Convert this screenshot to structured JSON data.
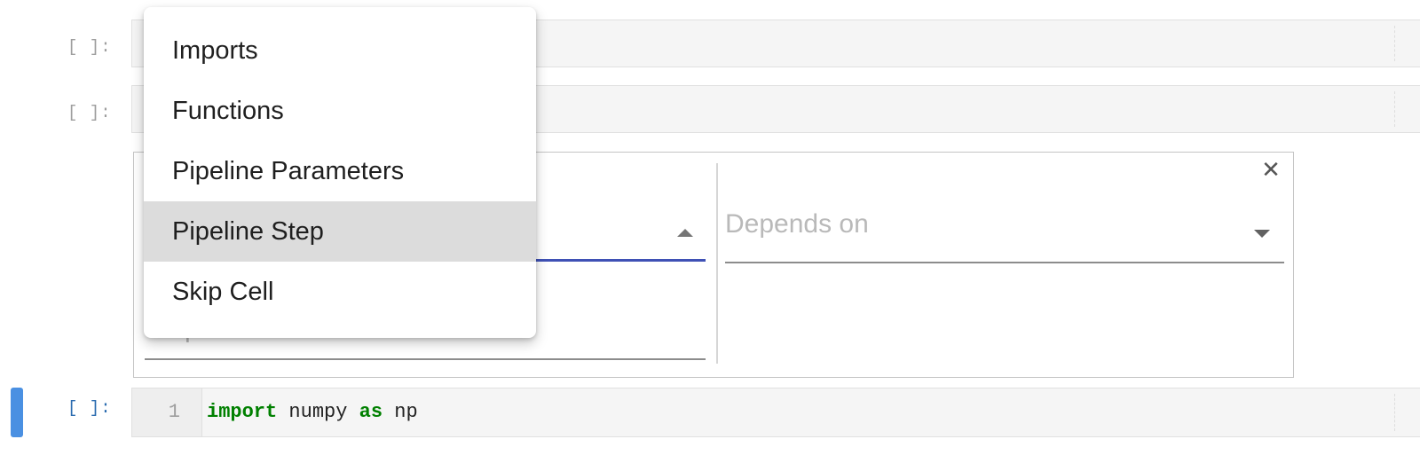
{
  "cells": [
    {
      "prompt": "[ ]:",
      "active": false
    },
    {
      "prompt": "[ ]:",
      "active": false
    },
    {
      "prompt": "[ ]:",
      "active": true,
      "line_number": "1",
      "code": {
        "kw1": "import",
        "mod": " numpy ",
        "kw2": "as",
        "alias": " np"
      }
    }
  ],
  "metadata_editor": {
    "close_icon": "close-icon",
    "depends_on_placeholder": "Depends on",
    "step_name_placeholder": "Step name"
  },
  "dropdown": {
    "items": [
      {
        "label": "Imports"
      },
      {
        "label": "Functions"
      },
      {
        "label": "Pipeline Parameters"
      },
      {
        "label": "Pipeline Step",
        "selected": true
      },
      {
        "label": "Skip Cell"
      }
    ]
  },
  "colors": {
    "active_cell_bar": "#4a90e2",
    "select_underline": "#3f51b5",
    "keyword": "#008000",
    "menu_highlight": "#dcdcdc"
  }
}
